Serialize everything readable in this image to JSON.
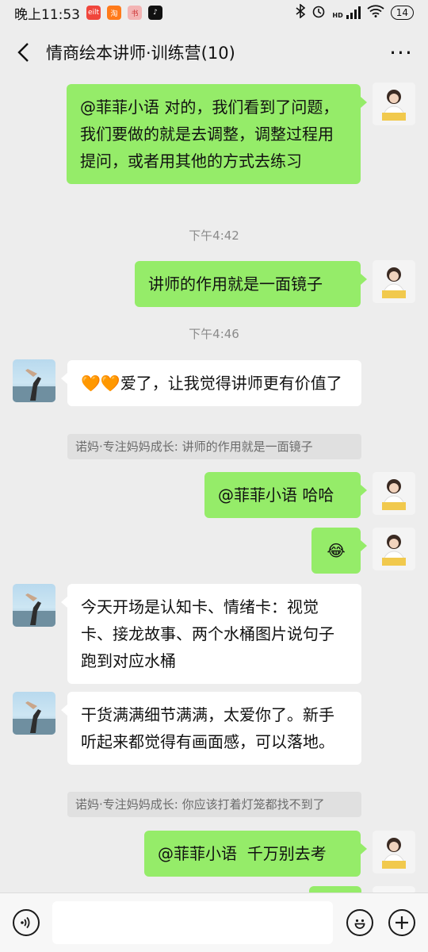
{
  "status": {
    "time": "晚上11:53",
    "app_icons": [
      {
        "name": "shopping-app-icon",
        "text": "eilt",
        "color": "#f0463c"
      },
      {
        "name": "taobao-app-icon",
        "text": "淘",
        "color": "#ff7a1a"
      },
      {
        "name": "xiaohongshu-app-icon",
        "text": "书",
        "color": "#f3b4b4"
      },
      {
        "name": "tiktok-app-icon",
        "text": "♪",
        "color": "#111111"
      }
    ],
    "network": "HD",
    "battery": "14"
  },
  "header": {
    "title": "情商绘本讲师·训练营(10)",
    "more": "···"
  },
  "messages": [
    {
      "side": "me",
      "text": "@菲菲小语 对的，我们看到了问题，我们要做的就是去调整，调整过程用提问，或者用其他的方式去练习"
    },
    {
      "time": "下午4:42"
    },
    {
      "side": "me",
      "text": "讲师的作用就是一面镜子"
    },
    {
      "time": "下午4:46"
    },
    {
      "side": "other",
      "text": "爱了，让我觉得讲师更有价值了",
      "emoji": "🧡🧡",
      "quote": "诺妈·专注妈妈成长: 讲师的作用就是一面镜子"
    },
    {
      "side": "me",
      "text": "@菲菲小语 哈哈"
    },
    {
      "side": "me",
      "text": "😂"
    },
    {
      "side": "other",
      "text": "今天开场是认知卡、情绪卡：视觉卡、接龙故事、两个水桶图片说句子跑到对应水桶"
    },
    {
      "side": "other",
      "text": "干货满满细节满满，太爱你了。新手听起来都觉得有画面感，可以落地。",
      "quote": "诺妈·专注妈妈成长: 你应该打着灯笼都找不到了"
    },
    {
      "side": "me",
      "text": "@菲菲小语  千万别去考"
    }
  ],
  "input": {
    "value": ""
  },
  "colors": {
    "bubble_me": "#95ec69",
    "bubble_other": "#ffffff",
    "background": "#ededed"
  }
}
